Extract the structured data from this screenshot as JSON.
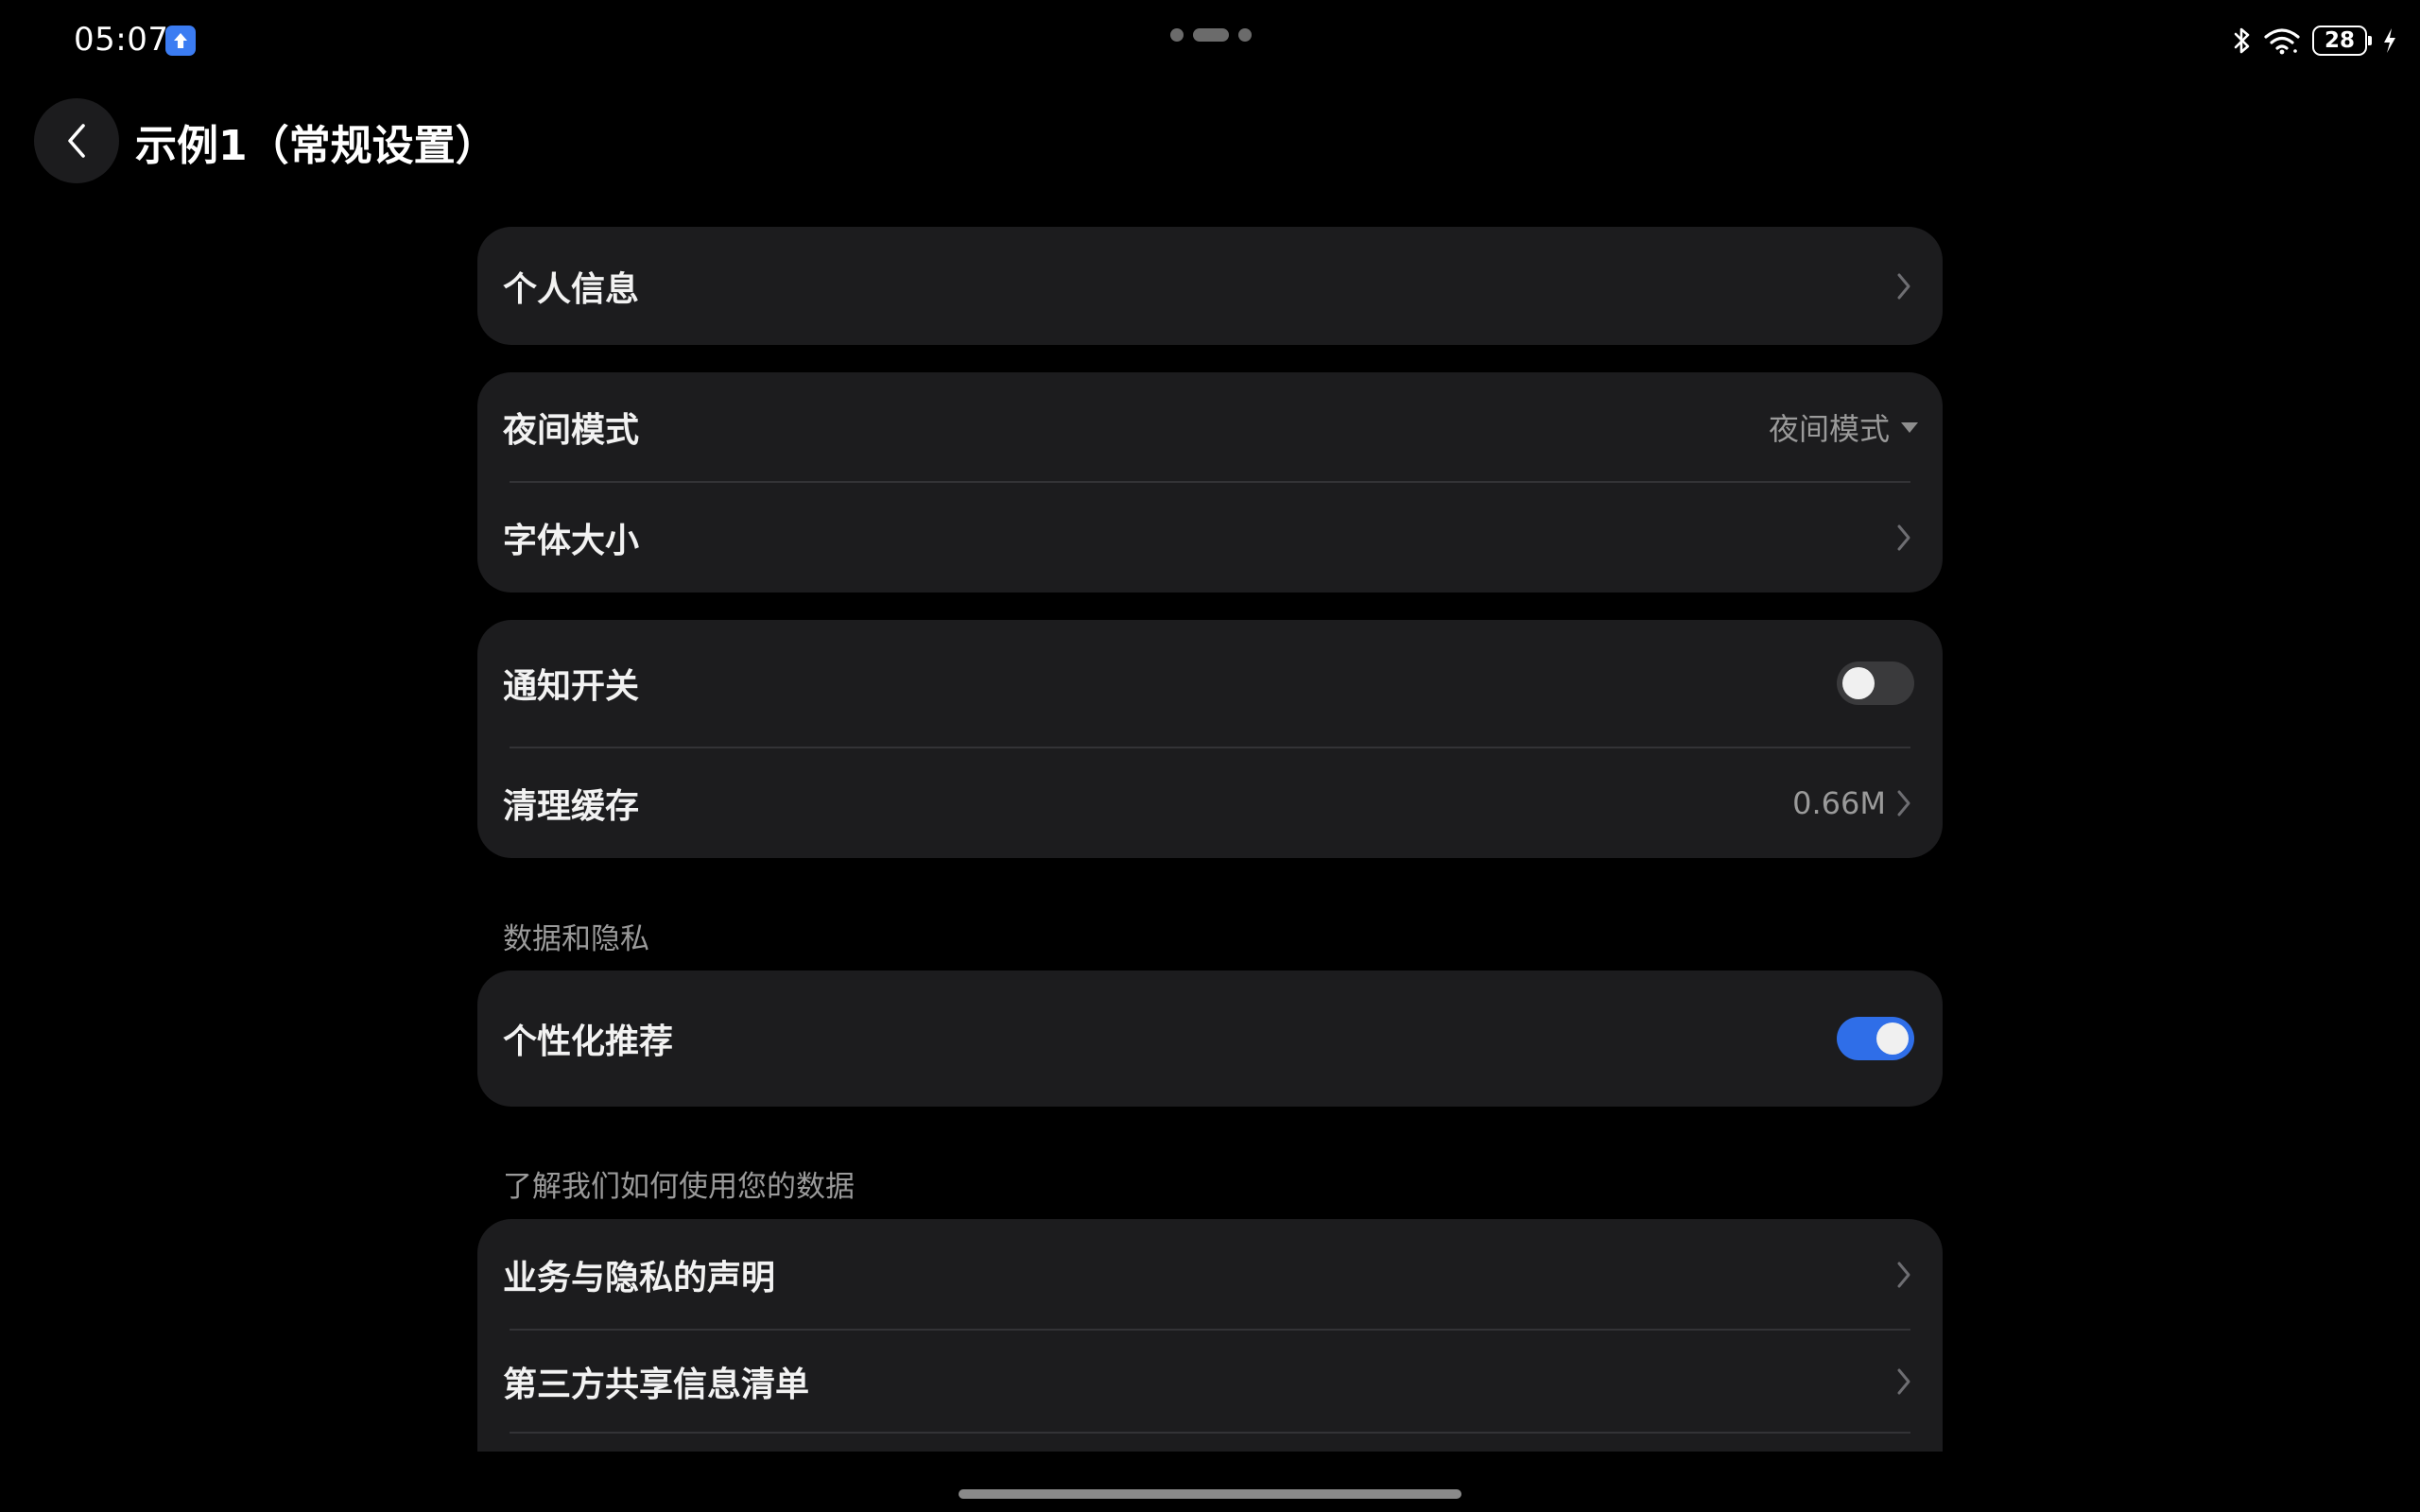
{
  "status_bar": {
    "time": "05:07",
    "battery_level": "28",
    "icons": [
      "app-upload-icon",
      "bluetooth-icon",
      "wifi-icon",
      "battery-icon",
      "charging-icon"
    ]
  },
  "header": {
    "back_icon": "chevron-left-icon",
    "title": "示例1（常规设置）"
  },
  "groups": {
    "profile": {
      "personal_info": "个人信息"
    },
    "display": {
      "night_mode_label": "夜间模式",
      "night_mode_value": "夜间模式",
      "font_size_label": "字体大小"
    },
    "general": {
      "notification_label": "通知开关",
      "notification_enabled": false,
      "clear_cache_label": "清理缓存",
      "cache_size": "0.66M"
    },
    "data_privacy": {
      "section_title": "数据和隐私",
      "personalized_label": "个性化推荐",
      "personalized_enabled": true
    },
    "data_usage": {
      "section_title": "了解我们如何使用您的数据",
      "privacy_statement_label": "业务与隐私的声明",
      "third_party_label": "第三方共享信息清单"
    }
  },
  "colors": {
    "background": "#000000",
    "card": "#1c1c1e",
    "accent": "#2f6ee8",
    "secondary_text": "#9a9a9a"
  }
}
